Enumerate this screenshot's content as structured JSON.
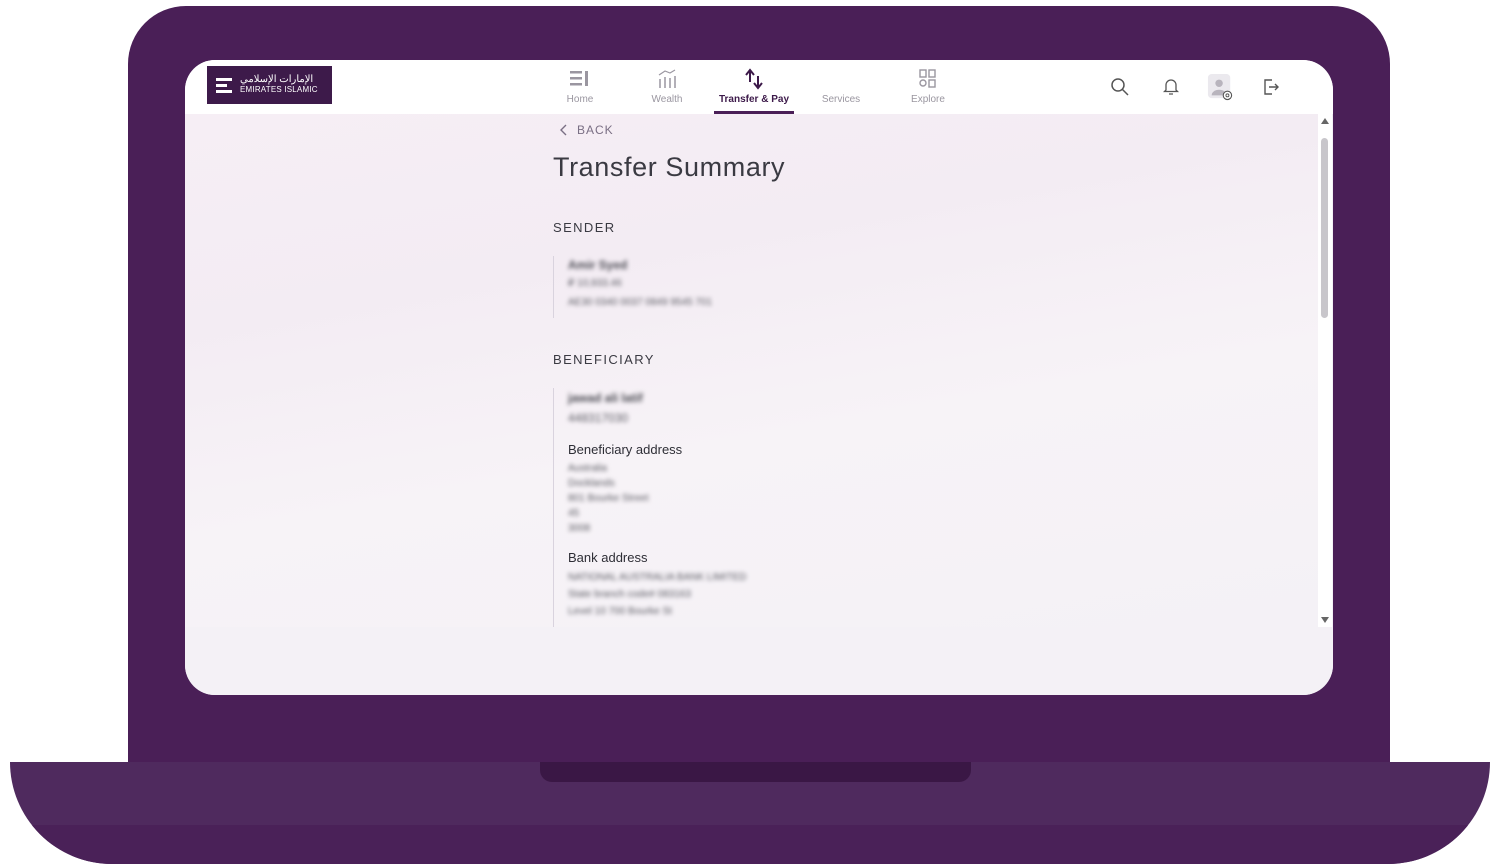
{
  "logo": {
    "arabic": "الإمارات الإسلامي",
    "english": "EMIRATES ISLAMIC"
  },
  "nav": {
    "items": [
      {
        "label": "Home",
        "icon": "home-icon"
      },
      {
        "label": "Wealth",
        "icon": "wealth-chart-icon"
      },
      {
        "label": "Transfer & Pay",
        "icon": "transfer-arrows-icon"
      },
      {
        "label": "Services",
        "icon": "services-icon"
      },
      {
        "label": "Explore",
        "icon": "explore-grid-icon"
      }
    ],
    "active": "Transfer & Pay"
  },
  "header_icons": [
    "search-icon",
    "bell-icon",
    "profile-settings-icon",
    "logout-icon"
  ],
  "page": {
    "back_label": "BACK",
    "title": "Transfer Summary"
  },
  "sender": {
    "section_label": "SENDER",
    "name": "Amir Syed",
    "balance": "₽ 10,933.46",
    "iban": "AE30 0340 0037 0849 9545 701"
  },
  "beneficiary": {
    "section_label": "BENEFICIARY",
    "name": "jawad ali latif",
    "account": "448317030",
    "address_heading": "Beneficiary address",
    "address_lines": [
      "Australia",
      "Docklands",
      "801 Bourke Street",
      "45",
      "3008"
    ],
    "bank_heading": "Bank address",
    "bank_lines": [
      "NATIONAL AUSTRALIA BANK LIMITED",
      "State branch code# 083163",
      "Level 10 700 Bourke St"
    ]
  },
  "colors": {
    "brand_purple": "#4a1f57",
    "logo_bg": "#3d1a4a",
    "page_bg": "#f4f1f6"
  }
}
